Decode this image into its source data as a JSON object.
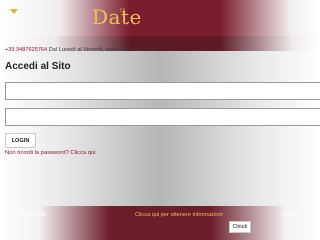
{
  "header": {
    "logo_text": "Date",
    "logo_mark": "☼",
    "menu_icon": "chevron-down-icon"
  },
  "contact": {
    "phone": "+39 3487625764",
    "hours": " Dal Lunedì al Venerdì, dalle 9.00 alle 18.00"
  },
  "login": {
    "title": "Accedi al Sito",
    "username_value": "",
    "password_value": "",
    "button_label": "LOGIN",
    "forgot_link": "Non ricordi la password? Clicca qui"
  },
  "cookie": {
    "text_left": "Questo sito",
    "link_label": "Clicca qui per ottenere informazioni",
    "text_right": "i cookie",
    "close_label": "Chiudi"
  },
  "colors": {
    "brand_burgundy": "#7a1c2c",
    "accent_gold": "#f0c24a"
  }
}
